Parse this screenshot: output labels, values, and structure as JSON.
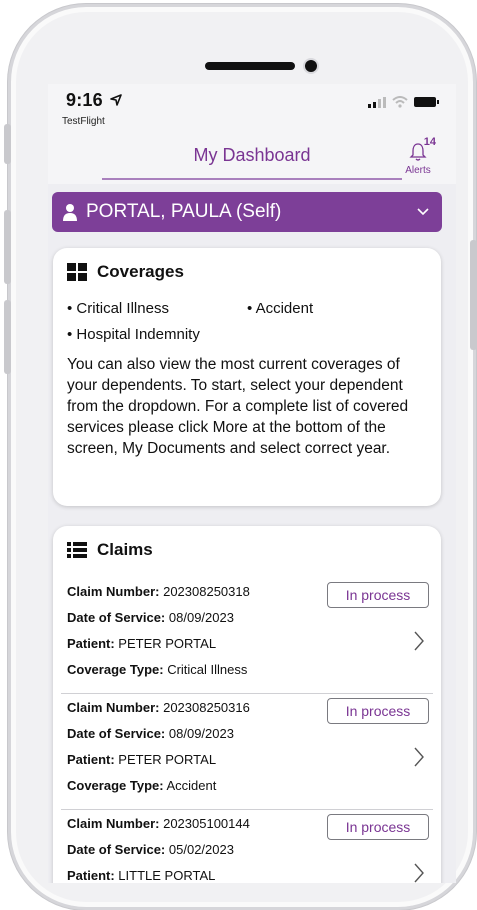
{
  "status_bar": {
    "time": "9:16",
    "carrier_app": "TestFlight"
  },
  "header": {
    "title": "My Dashboard",
    "alerts_label": "Alerts",
    "alerts_count": "14"
  },
  "profile": {
    "name": "PORTAL, PAULA (Self)"
  },
  "coverages": {
    "title": "Coverages",
    "items": [
      "Critical Illness",
      "Accident",
      "Hospital Indemnity"
    ],
    "description": "You can also view the most current coverages of your dependents. To start, select your dependent from the dropdown. For a complete list of covered services please click More at the bottom of the screen, My Documents and select correct year."
  },
  "claims": {
    "title": "Claims",
    "labels": {
      "claim_number": "Claim Number:",
      "date_of_service": "Date of Service:",
      "patient": "Patient:",
      "coverage_type": "Coverage Type:"
    },
    "rows": [
      {
        "claim_number": "202308250318",
        "date_of_service": "08/09/2023",
        "patient": "PETER PORTAL",
        "coverage_type": "Critical Illness",
        "status": "In process"
      },
      {
        "claim_number": "202308250316",
        "date_of_service": "08/09/2023",
        "patient": "PETER PORTAL",
        "coverage_type": "Accident",
        "status": "In process"
      },
      {
        "claim_number": "202305100144",
        "date_of_service": "05/02/2023",
        "patient": "LITTLE PORTAL",
        "coverage_type": "",
        "status": "In process"
      }
    ]
  },
  "colors": {
    "brand_purple": "#7d3f98",
    "title_purple": "#7a3593",
    "background": "#eeeef2"
  }
}
